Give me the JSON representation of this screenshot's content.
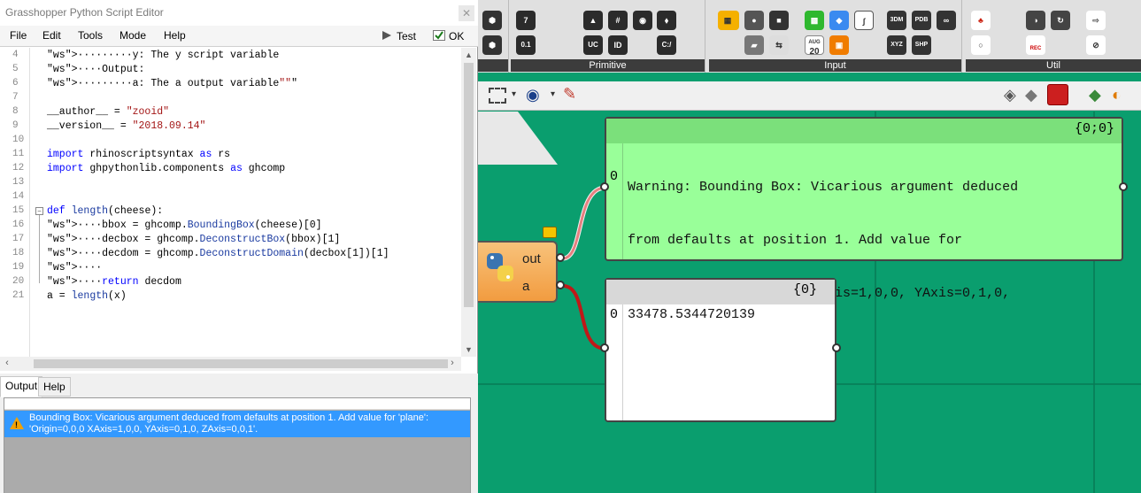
{
  "editor": {
    "title": "Grasshopper Python Script Editor",
    "close_glyph": "✕",
    "menus": [
      "File",
      "Edit",
      "Tools",
      "Mode",
      "Help"
    ],
    "test_label": "Test",
    "ok_label": "OK",
    "code_lines": [
      {
        "n": "4",
        "text": "·········y: The y script variable"
      },
      {
        "n": "5",
        "text": "····Output:"
      },
      {
        "n": "6",
        "text": "·········a: The a output variable\"\"\""
      },
      {
        "n": "7",
        "text": ""
      },
      {
        "n": "8",
        "text": "__author__ = \"zooid\""
      },
      {
        "n": "9",
        "text": "__version__ = \"2018.09.14\""
      },
      {
        "n": "10",
        "text": ""
      },
      {
        "n": "11",
        "text": "import rhinoscriptsyntax as rs"
      },
      {
        "n": "12",
        "text": "import ghpythonlib.components as ghcomp"
      },
      {
        "n": "13",
        "text": ""
      },
      {
        "n": "14",
        "text": ""
      },
      {
        "n": "15",
        "text": "def length(cheese):"
      },
      {
        "n": "16",
        "text": "····bbox = ghcomp.BoundingBox(cheese)[0]"
      },
      {
        "n": "17",
        "text": "····decbox = ghcomp.DeconstructBox(bbox)[1]"
      },
      {
        "n": "18",
        "text": "····decdom = ghcomp.DeconstructDomain(decbox[1])[1]"
      },
      {
        "n": "19",
        "text": "····"
      },
      {
        "n": "20",
        "text": "····return decdom"
      },
      {
        "n": "21",
        "text": "a = length(x)"
      }
    ],
    "tabs": [
      "Output",
      "Help"
    ],
    "output_message": "Bounding Box: Vicarious argument deduced from defaults at position 1. Add value for 'plane': 'Origin=0,0,0 XAxis=1,0,0, YAxis=0,1,0, ZAxis=0,0,1'."
  },
  "ribbon": {
    "groups": [
      "Primitive",
      "Input",
      "Util"
    ],
    "icon_text": {
      "num7": "7",
      "num01": "0.1",
      "uc": "UC",
      "id": "ID",
      "cl": "C:/",
      "aug": "AUG",
      "day": "20",
      "3dm": "3DM",
      "pdb": "PDB",
      "xyz": "XYZ",
      "shp": "SHP",
      "rec": "REC"
    }
  },
  "component": {
    "outputs": [
      "out",
      "a"
    ]
  },
  "panels": {
    "warning": {
      "path": "{0;0}",
      "index": "0",
      "lines": [
        "Warning: Bounding Box: Vicarious argument deduced",
        "from defaults at position 1. Add value for",
        "'plane': 'Origin=0,0,0 XAxis=1,0,0, YAxis=0,1,0,",
        "ZAxis=0,0,1'."
      ]
    },
    "value": {
      "path": "{0}",
      "index": "0",
      "value": "33478.5344720139"
    }
  },
  "colors": {
    "canvas": "#0a9e6e",
    "warning_panel": "#99ff99",
    "warning_header": "#7be07b",
    "selection": "#3399ff",
    "wire_red": "#c01818"
  }
}
